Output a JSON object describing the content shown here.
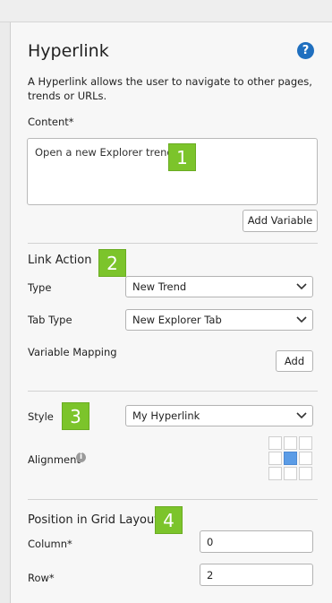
{
  "panel": {
    "title": "Hyperlink",
    "help_icon": "?",
    "description": "A Hyperlink allows the user to navigate to other pages, trends or URLs."
  },
  "content": {
    "label": "Content*",
    "value": "Open a new Explorer trend",
    "add_variable_label": "Add Variable"
  },
  "link_action": {
    "title": "Link Action",
    "type_label": "Type",
    "type_value": "New Trend",
    "tab_type_label": "Tab Type",
    "tab_type_value": "New Explorer Tab",
    "variable_mapping_label": "Variable Mapping",
    "add_label": "Add"
  },
  "style_section": {
    "style_label": "Style",
    "style_value": "My Hyperlink",
    "alignment_label": "Alignment",
    "alignment_info_icon": "i",
    "alignment_selected": "middle-center"
  },
  "position": {
    "title": "Position in Grid Layout",
    "column_label": "Column*",
    "column_value": "0",
    "row_label": "Row*",
    "row_value": "2"
  },
  "badges": [
    "1",
    "2",
    "3",
    "4"
  ],
  "colors": {
    "badge": "#7cc42b",
    "help": "#1f6fbf",
    "alignment_selected": "#5b9ce6"
  }
}
